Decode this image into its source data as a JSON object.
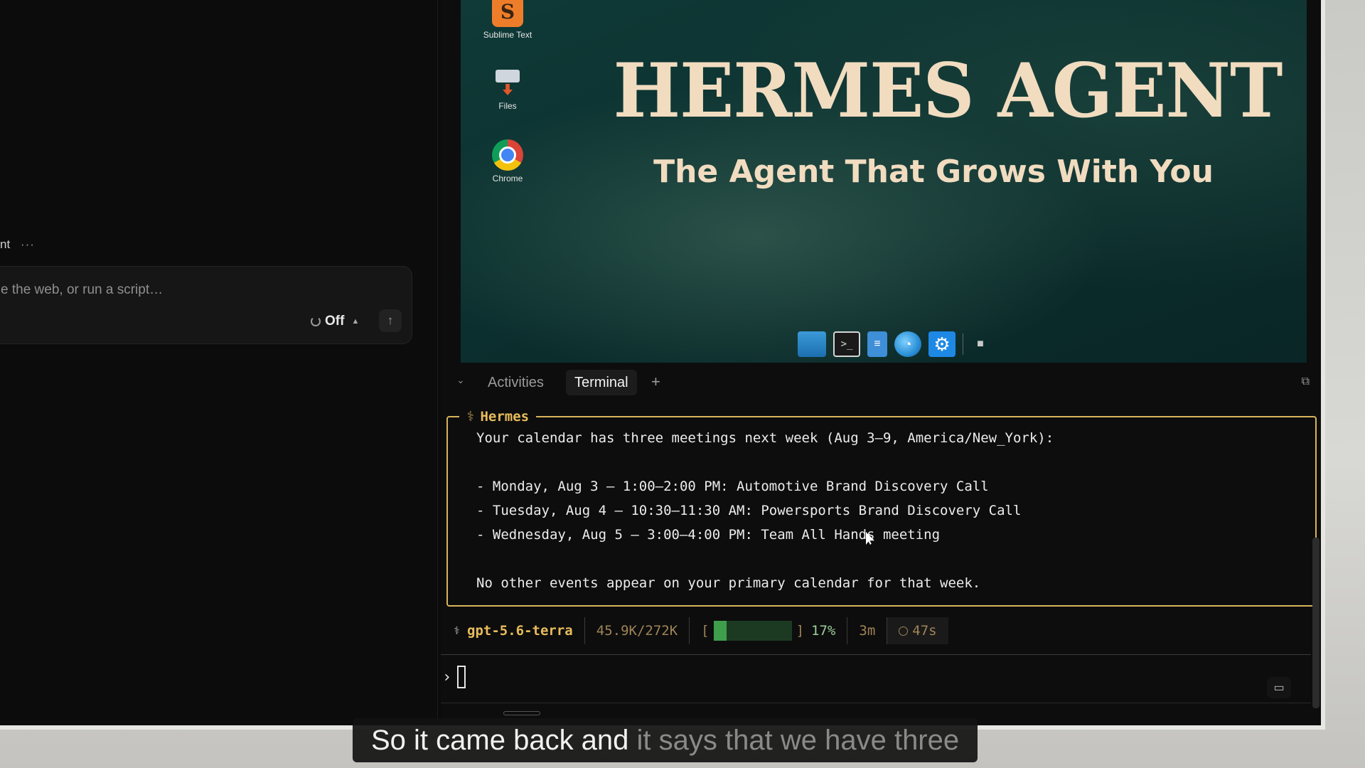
{
  "left_panel": {
    "agent_title": "nt",
    "more_label": "···",
    "composer": {
      "placeholder": "e the web, or run a script…",
      "think_label": "Off",
      "send_icon": "arrow-up-icon"
    }
  },
  "desktop": {
    "icons": [
      {
        "label": "Sublime Text",
        "icon": "sublime-text-icon"
      },
      {
        "label": "Files",
        "icon": "files-icon"
      },
      {
        "label": "Chrome",
        "icon": "chrome-icon"
      }
    ],
    "title": "HERMES AGENT",
    "subtitle": "The Agent That Grows With You",
    "dock": [
      "window-icon",
      "terminal-icon",
      "document-icon",
      "globe-icon",
      "settings-icon",
      "folder-icon"
    ]
  },
  "tabs": {
    "activities": "Activities",
    "terminal": "Terminal",
    "add": "+"
  },
  "hermes_message": {
    "label": "Hermes",
    "lines": [
      "Your calendar has three meetings next week (Aug 3–9, America/New_York):",
      "- Monday, Aug 3 — 1:00–2:00 PM: Automotive Brand Discovery Call",
      "- Tuesday, Aug 4 — 10:30–11:30 AM: Powersports Brand Discovery Call",
      "- Wednesday, Aug 5 — 3:00–4:00 PM: Team All Hands meeting",
      "No other events appear on your primary calendar for that week."
    ]
  },
  "status": {
    "model": "gpt-5.6-terra",
    "tokens": "45.9K/272K",
    "context_percent_label": "17%",
    "context_fraction": 0.17,
    "bar_open": "[",
    "bar_close": "]",
    "elapsed": "3m",
    "timer": "47s"
  },
  "prompt": {
    "symbol": "›"
  },
  "caption": {
    "spoken": "So it came back and ",
    "upcoming": "it says that we have three"
  },
  "colors": {
    "accent_gold": "#e8bc5c",
    "hero_text": "#f1dcc0",
    "progress_green": "#3e9e4c"
  }
}
